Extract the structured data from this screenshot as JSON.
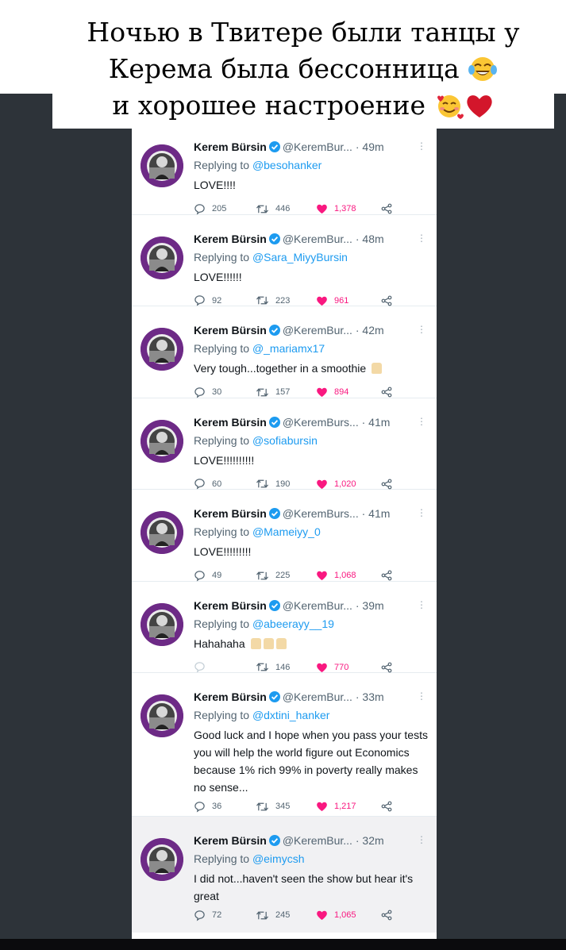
{
  "caption": {
    "line1": "Ночью в Твитере были танцы у",
    "line2": "Керема была бессонница",
    "line3": "и хорошее настроение",
    "emoji1": "tears-of-joy-emoji",
    "emoji2": "smiling-face-with-hearts-emoji",
    "emoji3": "red-heart-emoji"
  },
  "colors": {
    "background": "#2d3339",
    "link": "#1d9bf0",
    "like": "#f91880",
    "verified": "#1d9bf0"
  },
  "tweets": [
    {
      "name": "Kerem Bürsin",
      "handle": "@KeremBur...",
      "time": "49m",
      "reply_prefix": "Replying to",
      "reply_to": "@besohanker",
      "text": "LOVE!!!!",
      "replies": "205",
      "retweets": "446",
      "likes": "1,378"
    },
    {
      "name": "Kerem Bürsin",
      "handle": "@KeremBur...",
      "time": "48m",
      "reply_prefix": "Replying to",
      "reply_to": "@Sara_MiyyBursin",
      "text": "LOVE!!!!!!",
      "replies": "92",
      "retweets": "223",
      "likes": "961"
    },
    {
      "name": "Kerem Bürsin",
      "handle": "@KeremBur...",
      "time": "42m",
      "reply_prefix": "Replying to",
      "reply_to": "@_mariamx17",
      "text": "Very tough...together in a smoothie",
      "replies": "30",
      "retweets": "157",
      "likes": "894"
    },
    {
      "name": "Kerem Bürsin",
      "handle": "@KeremBurs...",
      "time": "41m",
      "reply_prefix": "Replying to",
      "reply_to": "@sofiabursin",
      "text": "LOVE!!!!!!!!!!",
      "replies": "60",
      "retweets": "190",
      "likes": "1,020"
    },
    {
      "name": "Kerem Bürsin",
      "handle": "@KeremBurs...",
      "time": "41m",
      "reply_prefix": "Replying to",
      "reply_to": "@Mameiyy_0",
      "text": "LOVE!!!!!!!!!",
      "replies": "49",
      "retweets": "225",
      "likes": "1,068"
    },
    {
      "name": "Kerem Bürsin",
      "handle": "@KeremBur...",
      "time": "39m",
      "reply_prefix": "Replying to",
      "reply_to": "@abeerayy__19",
      "text": "Hahahaha",
      "replies": "",
      "retweets": "146",
      "likes": "770"
    },
    {
      "name": "Kerem Bürsin",
      "handle": "@KeremBur...",
      "time": "33m",
      "reply_prefix": "Replying to",
      "reply_to": "@dxtini_hanker",
      "text": "Good luck and I hope when you pass your tests you will help the world figure out Economics because 1% rich 99% in poverty really makes no sense...",
      "replies": "36",
      "retweets": "345",
      "likes": "1,217"
    },
    {
      "name": "Kerem Bürsin",
      "handle": "@KeremBur...",
      "time": "32m",
      "reply_prefix": "Replying to",
      "reply_to": "@eimycsh",
      "text": "I did not...haven't seen the show but hear it's great",
      "replies": "72",
      "retweets": "245",
      "likes": "1,065"
    }
  ]
}
